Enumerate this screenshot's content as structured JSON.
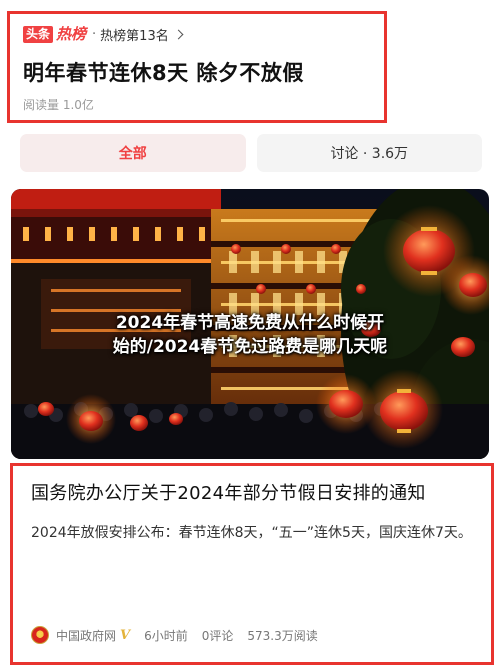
{
  "hot_card": {
    "brand_toutiao": "头条",
    "brand_rebang": "热榜",
    "separator": "·",
    "rank": "热榜第13名",
    "title": "明年春节连休8天 除夕不放假",
    "views": "阅读量 1.0亿"
  },
  "tabs": [
    {
      "label": "全部",
      "active": true
    },
    {
      "label": "讨论 · 3.6万",
      "active": false
    }
  ],
  "image": {
    "caption_line1": "2024年春节高速免费从什么时候开",
    "caption_line2": "始的/2024春节免过路费是哪几天呢"
  },
  "article": {
    "title": "国务院办公厅关于2024年部分节假日安排的通知",
    "summary": "2024年放假安排公布：春节连休8天，“五一”连休5天，国庆连休7天。",
    "source": "中国政府网",
    "verified_mark": "V",
    "time": "6小时前",
    "comments": "0评论",
    "reads": "573.3万阅读"
  },
  "colors": {
    "accent_red": "#f04142",
    "highlight_border": "#e8342f",
    "lantern_red": "#e0301e",
    "night_sky": "#0a0e1c"
  }
}
